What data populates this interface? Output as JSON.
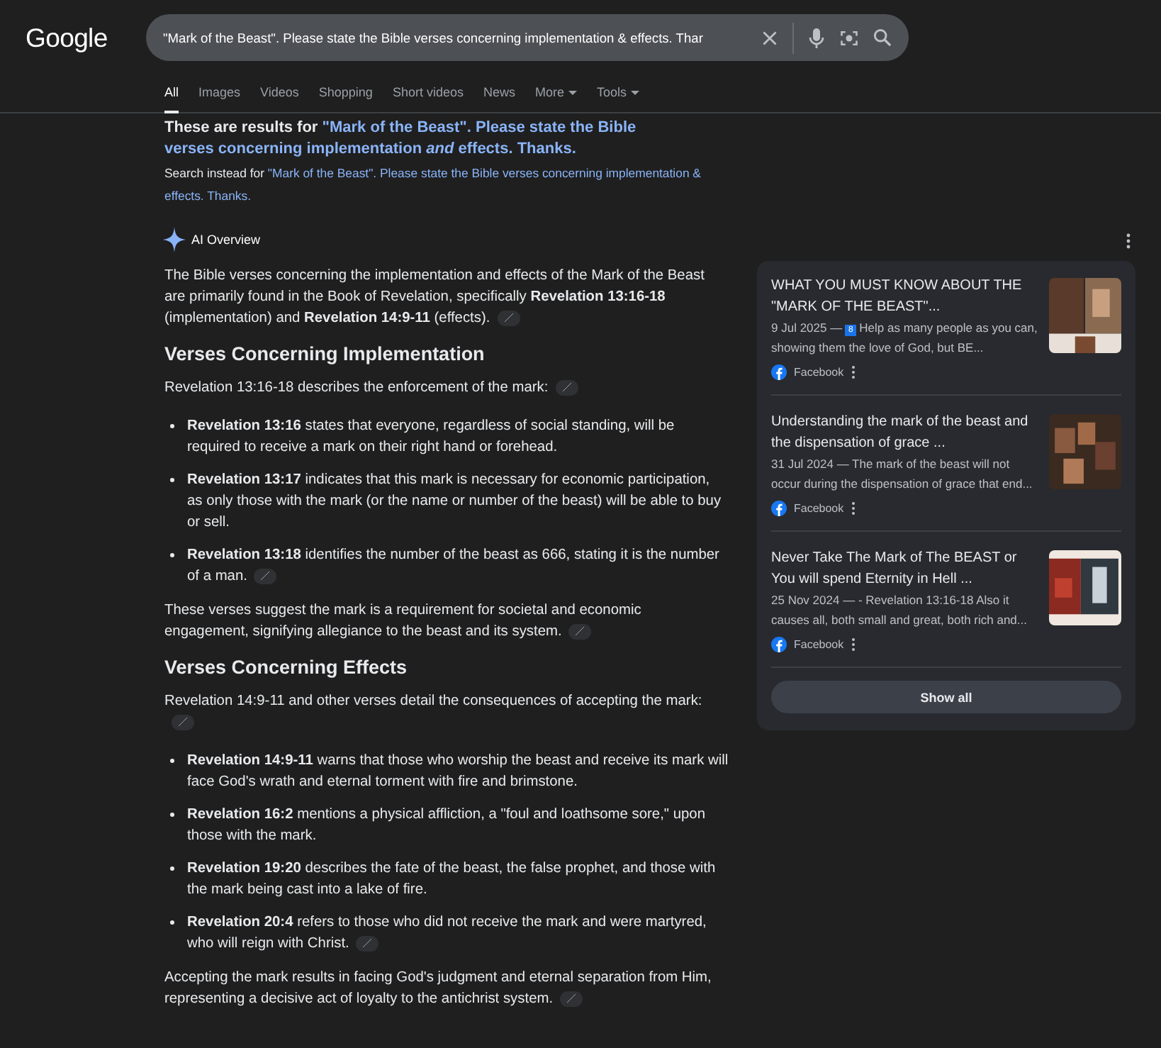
{
  "header": {
    "logo": "Google",
    "search": {
      "value": "\"Mark of the Beast\". Please state the Bible verses concerning implementation & effects. Thar"
    }
  },
  "tabs": [
    {
      "label": "All",
      "selected": true,
      "dropdown": false
    },
    {
      "label": "Images",
      "selected": false,
      "dropdown": false
    },
    {
      "label": "Videos",
      "selected": false,
      "dropdown": false
    },
    {
      "label": "Shopping",
      "selected": false,
      "dropdown": false
    },
    {
      "label": "Short videos",
      "selected": false,
      "dropdown": false
    },
    {
      "label": "News",
      "selected": false,
      "dropdown": false
    },
    {
      "label": "More",
      "selected": false,
      "dropdown": true
    },
    {
      "label": "Tools",
      "selected": false,
      "dropdown": true
    }
  ],
  "correction": {
    "label": "These are results for",
    "query": "\"Mark of the Beast\". Please state the Bible verses concerning implementation *and* effects. Thanks.",
    "instead_label": "Search instead for",
    "instead_query": "\"Mark of the Beast\". Please state the Bible verses concerning implementation & effects. Thanks."
  },
  "ai_overview": {
    "title": "AI Overview",
    "blocks": [
      {
        "kind": "para",
        "text": "The Bible verses concerning the implementation and effects of the Mark of the Beast are primarily found in the Book of Revelation, specifically **Revelation 13:16-18** (implementation) and **Revelation 14:9-11** (effects).",
        "source_link": true
      },
      {
        "kind": "heading",
        "text": "Verses Concerning Implementation"
      },
      {
        "kind": "para",
        "text": "Revelation 13:16-18 describes the enforcement of the mark:",
        "source_link": true
      },
      {
        "kind": "bullets",
        "items": [
          {
            "text": "**Revelation 13:16** states that everyone, regardless of social standing, will be required to receive a mark on their right hand or forehead.",
            "source_link": false
          },
          {
            "text": "**Revelation 13:17** indicates that this mark is necessary for economic participation, as only those with the mark (or the name or number of the beast) will be able to buy or sell.",
            "source_link": false
          },
          {
            "text": "**Revelation 13:18** identifies the number of the beast as 666, stating it is the number of a man.",
            "source_link": true
          }
        ]
      },
      {
        "kind": "para",
        "text": "These verses suggest the mark is a requirement for societal and economic engagement, signifying allegiance to the beast and its system.",
        "source_link": true
      },
      {
        "kind": "heading",
        "text": "Verses Concerning Effects"
      },
      {
        "kind": "para",
        "text": "Revelation 14:9-11 and other verses detail the consequences of accepting the mark:",
        "source_link": true
      },
      {
        "kind": "bullets",
        "items": [
          {
            "text": "**Revelation 14:9-11** warns that those who worship the beast and receive its mark will face God's wrath and eternal torment with fire and brimstone.",
            "source_link": false
          },
          {
            "text": "**Revelation 16:2** mentions a physical affliction, a \"foul and loathsome sore,\" upon those with the mark.",
            "source_link": false
          },
          {
            "text": "**Revelation 19:20** describes the fate of the beast, the false prophet, and those with the mark being cast into a lake of fire.",
            "source_link": false
          },
          {
            "text": "**Revelation 20:4** refers to those who did not receive the mark and were martyred, who will reign with Christ.",
            "source_link": true
          }
        ]
      },
      {
        "kind": "para",
        "text": "Accepting the mark results in facing God's judgment and eternal separation from Him, representing a decisive act of loyalty to the antichrist system.",
        "source_link": true
      }
    ]
  },
  "sources": {
    "items": [
      {
        "title": "WHAT YOU MUST KNOW ABOUT THE \"MARK OF THE BEAST\"...",
        "date": "9 Jul 2025 —",
        "badge": "8",
        "snippet": "Help as many people as you can, showing them the love of God, but BE...",
        "site": "Facebook"
      },
      {
        "title": "Understanding the mark of the beast and the dispensation of grace ...",
        "date": "31 Jul 2024 —",
        "snippet": "The mark of the beast will not occur during the dispensation of grace that end...",
        "site": "Facebook"
      },
      {
        "title": "Never Take The Mark of The BEAST or You will spend Eternity in Hell ...",
        "date": "25 Nov 2024 —",
        "snippet": "- Revelation 13:16-18 Also it causes all, both small and great, both rich and...",
        "site": "Facebook"
      }
    ],
    "show_all": "Show all"
  }
}
